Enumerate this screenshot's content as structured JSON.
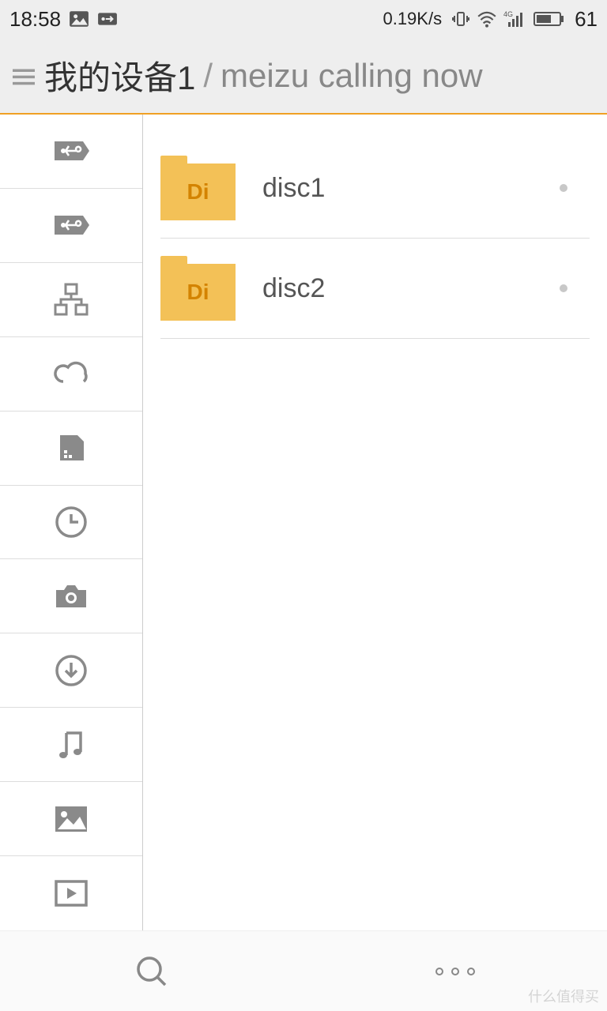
{
  "status": {
    "time": "18:58",
    "speed": "0.19K/s",
    "network_label": "4G",
    "battery": "61"
  },
  "breadcrumb": {
    "primary": "我的设备1",
    "separator": "/",
    "secondary": "meizu calling now"
  },
  "sidebar": {
    "items": [
      {
        "icon": "usb-icon"
      },
      {
        "icon": "usb-icon"
      },
      {
        "icon": "lan-icon"
      },
      {
        "icon": "cloud-icon"
      },
      {
        "icon": "sdcard-icon"
      },
      {
        "icon": "clock-icon"
      },
      {
        "icon": "camera-icon"
      },
      {
        "icon": "download-icon"
      },
      {
        "icon": "music-icon"
      },
      {
        "icon": "picture-icon"
      },
      {
        "icon": "video-icon"
      }
    ]
  },
  "files": [
    {
      "badge": "Di",
      "name": "disc1"
    },
    {
      "badge": "Di",
      "name": "disc2"
    }
  ],
  "bottombar": {
    "search": "search",
    "more": "more"
  },
  "watermark": "什么值得买"
}
